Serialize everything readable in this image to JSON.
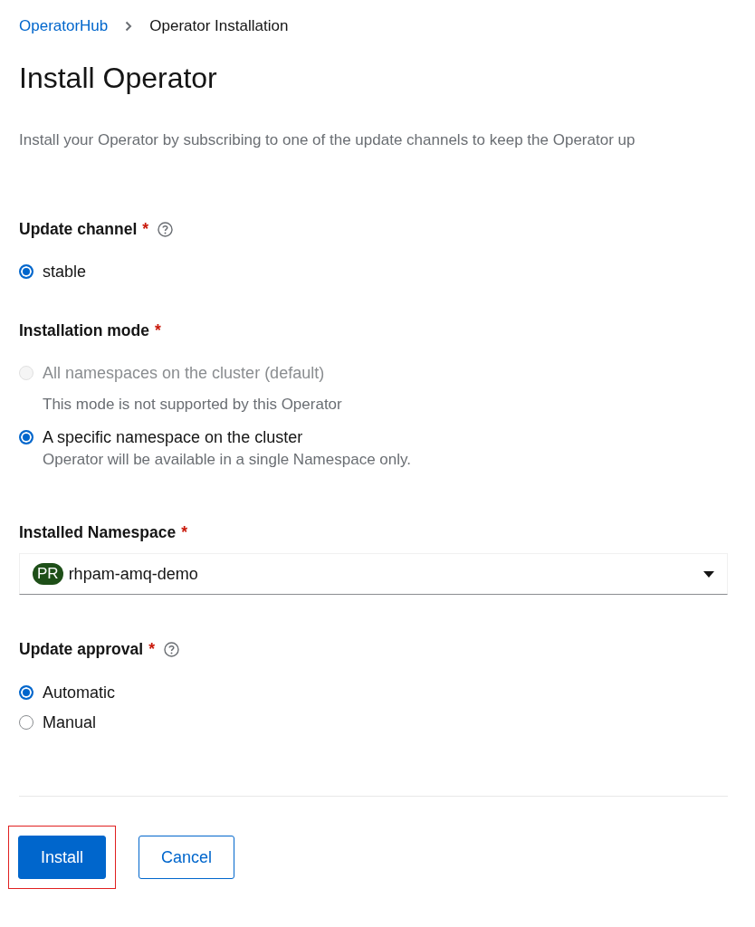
{
  "breadcrumb": [
    {
      "label": "OperatorHub",
      "kind": "link"
    },
    {
      "label": "Operator Installation",
      "kind": "current"
    }
  ],
  "title": "Install Operator",
  "description": "Install your Operator by subscribing to one of the update channels to keep the Operator up",
  "sections": [
    {
      "kind": "radio",
      "label": "Update channel",
      "required_mark": "*",
      "help": true,
      "options": [
        {
          "label": "stable",
          "selected": true,
          "disabled": false
        }
      ]
    },
    {
      "kind": "radio",
      "label": "Installation mode",
      "required_mark": "*",
      "help": false,
      "options": [
        {
          "label": "All namespaces on the cluster (default)",
          "description": "This mode is not supported by this Operator",
          "selected": false,
          "disabled": true
        },
        {
          "label": "A specific namespace on the cluster",
          "description": "Operator will be available in a single Namespace only.",
          "selected": true,
          "disabled": false
        }
      ]
    },
    {
      "kind": "select",
      "label": "Installed Namespace",
      "required_mark": "*",
      "help": false,
      "badge": "PR",
      "value": "rhpam-amq-demo"
    },
    {
      "kind": "radio",
      "label": "Update approval",
      "required_mark": "*",
      "help": true,
      "options": [
        {
          "label": "Automatic",
          "selected": true,
          "disabled": false
        },
        {
          "label": "Manual",
          "selected": false,
          "disabled": false
        }
      ]
    }
  ],
  "buttons": [
    {
      "label": "Install",
      "kind": "primary",
      "highlighted": true
    },
    {
      "label": "Cancel",
      "kind": "secondary",
      "highlighted": false
    }
  ]
}
